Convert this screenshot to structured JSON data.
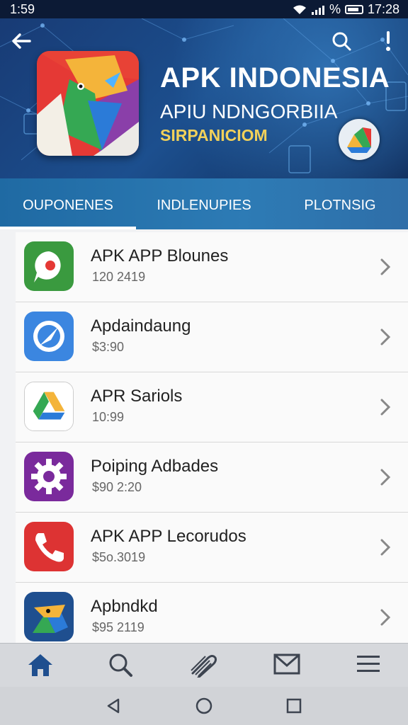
{
  "status_bar": {
    "time": "1:59",
    "battery_label": "%",
    "clock": "17:28"
  },
  "header": {
    "title": "APK INDONESIA",
    "subtitle": "APIU NDNGORBIIA",
    "brand": "SIRPANICIOM"
  },
  "tabs": [
    {
      "label": "OUPONENES",
      "active": true
    },
    {
      "label": "INDLENUPIES",
      "active": false
    },
    {
      "label": "PLOTNSIG",
      "active": false
    }
  ],
  "apps": [
    {
      "name": "APK APP Blounes",
      "price": "120 2419",
      "icon": "chat-bubble-icon",
      "color": "#3a9a3f"
    },
    {
      "name": "Apdaindaung",
      "price": "$3:90",
      "icon": "compass-icon",
      "color": "#3b86e0"
    },
    {
      "name": "APR Sariols",
      "price": "10:99",
      "icon": "drive-triangle-icon",
      "color": "#ffffff"
    },
    {
      "name": "Poiping Adbades",
      "price": "$90 2:20",
      "icon": "settings-gear-icon",
      "color": "#7a2a9c"
    },
    {
      "name": "APK APP Lecorudos",
      "price": "$5o.3019",
      "icon": "phone-icon",
      "color": "#dd3333"
    },
    {
      "name": "Apbndkd",
      "price": "$95 2119",
      "icon": "fox-triangle-icon",
      "color": "#1f4f8f"
    }
  ],
  "bottom_nav": [
    "home-icon",
    "search-icon",
    "attachment-icon",
    "mail-icon",
    "menu-icon"
  ],
  "system_nav": [
    "back-triangle-icon",
    "home-circle-icon",
    "recents-square-icon"
  ],
  "colors": {
    "accent": "#2d7bb5",
    "header_dark": "#183b75",
    "brand_yellow": "#f2d15a"
  }
}
